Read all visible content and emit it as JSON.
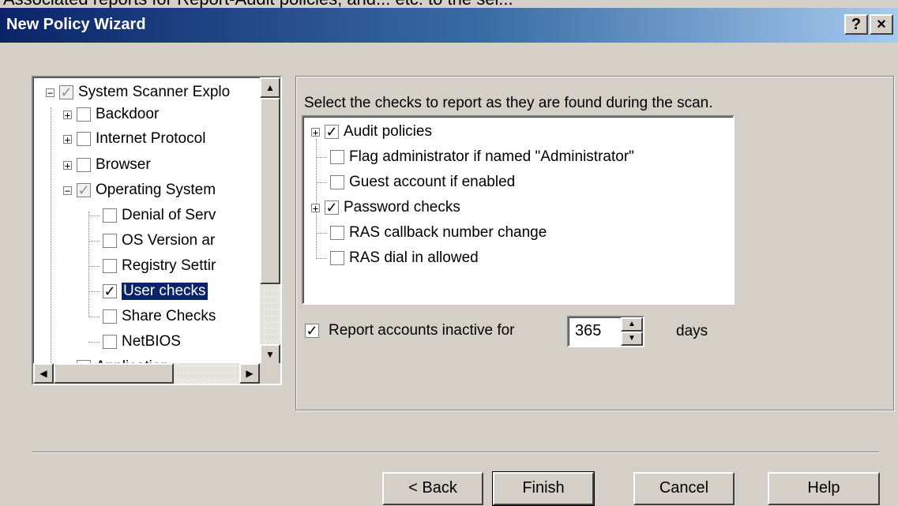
{
  "window": {
    "cutoff_text": "Associated reports for Report-Audit policies, and... etc. to the sel...",
    "title": "New Policy Wizard",
    "help_button": "?",
    "close_button": "×"
  },
  "tree": {
    "items": [
      {
        "label": "System Scanner Explo",
        "expander": "−",
        "check": "✓",
        "checked": "grey"
      },
      {
        "label": "Backdoor",
        "expander": "+",
        "check": ""
      },
      {
        "label": "Internet Protocol",
        "expander": "+",
        "check": ""
      },
      {
        "label": "Browser",
        "expander": "+",
        "check": ""
      },
      {
        "label": "Operating System",
        "expander": "−",
        "check": "✓",
        "checked": "grey"
      },
      {
        "label": "Denial of Serv",
        "check": ""
      },
      {
        "label": "OS Version ar",
        "check": ""
      },
      {
        "label": "Registry Settir",
        "check": ""
      },
      {
        "label": "User checks",
        "check": "✓",
        "selected": true
      },
      {
        "label": "Share Checks",
        "check": ""
      },
      {
        "label": "NetBIOS",
        "check": ""
      },
      {
        "label": "Application",
        "expander": "+",
        "check": ""
      }
    ],
    "scroll_up": "▲",
    "scroll_down": "▼",
    "scroll_left": "◀",
    "scroll_right": "▶"
  },
  "checks_panel": {
    "instruction": "Select the checks to report as they are found during the scan.",
    "items": [
      {
        "label": "Audit policies",
        "expander": "+",
        "check": "✓"
      },
      {
        "label": "Flag administrator if named \"Administrator\"",
        "check": ""
      },
      {
        "label": "Guest account if enabled",
        "check": ""
      },
      {
        "label": "Password checks",
        "expander": "+",
        "check": "✓"
      },
      {
        "label": "RAS callback number change",
        "check": ""
      },
      {
        "label": "RAS dial in allowed",
        "check": ""
      }
    ],
    "inactive": {
      "check": "✓",
      "label": "Report accounts inactive for",
      "value": "365",
      "unit": "days",
      "spin_up": "▲",
      "spin_down": "▼"
    }
  },
  "buttons": {
    "back": "< Back",
    "finish": "Finish",
    "cancel": "Cancel",
    "help": "Help"
  }
}
